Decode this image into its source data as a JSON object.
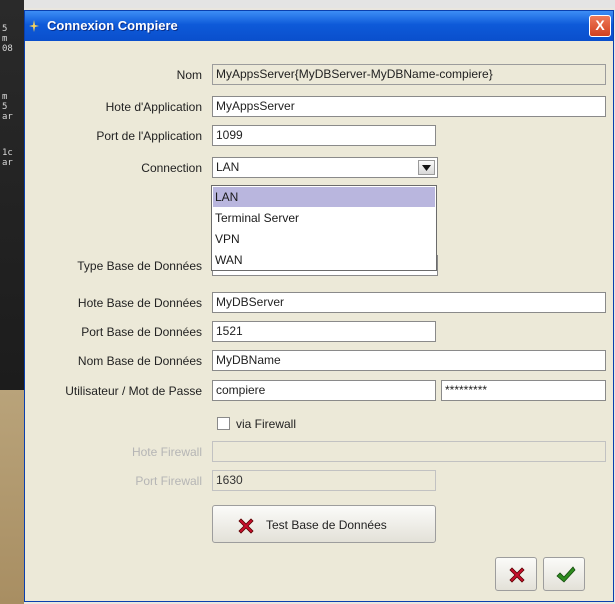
{
  "window": {
    "title": "Connexion Compiere",
    "close_glyph": "X"
  },
  "form": {
    "nom": {
      "label": "Nom",
      "value": "MyAppsServer{MyDBServer-MyDBName-compiere}"
    },
    "hote_app": {
      "label": "Hote d'Application",
      "value": "MyAppsServer"
    },
    "port_app": {
      "label": "Port de l'Application",
      "value": "1099"
    },
    "connection": {
      "label": "Connection",
      "value": "LAN",
      "options": [
        "LAN",
        "Terminal Server",
        "VPN",
        "WAN"
      ]
    },
    "type_bd": {
      "label": "Type Base de Données"
    },
    "hote_bd": {
      "label": "Hote Base de Données",
      "value": "MyDBServer"
    },
    "port_bd": {
      "label": "Port Base de Données",
      "value": "1521"
    },
    "nom_bd": {
      "label": "Nom Base de Données",
      "value": "MyDBName"
    },
    "user": {
      "label": "Utilisateur / Mot de Passe",
      "value": "compiere",
      "password_mask": "*********"
    },
    "firewall": {
      "label": "via Firewall",
      "checked": false
    },
    "hote_firewall": {
      "label": "Hote Firewall",
      "value": ""
    },
    "port_firewall": {
      "label": "Port Firewall",
      "value": "1630"
    }
  },
  "buttons": {
    "test_db": "Test Base de Données",
    "cancel": "cancel-icon",
    "ok": "ok-icon"
  },
  "colors": {
    "title_blue": "#0e5ad9",
    "error_red": "#c8102e",
    "ok_green": "#2e8b1e",
    "dropdown_selection": "#b9b6de"
  }
}
